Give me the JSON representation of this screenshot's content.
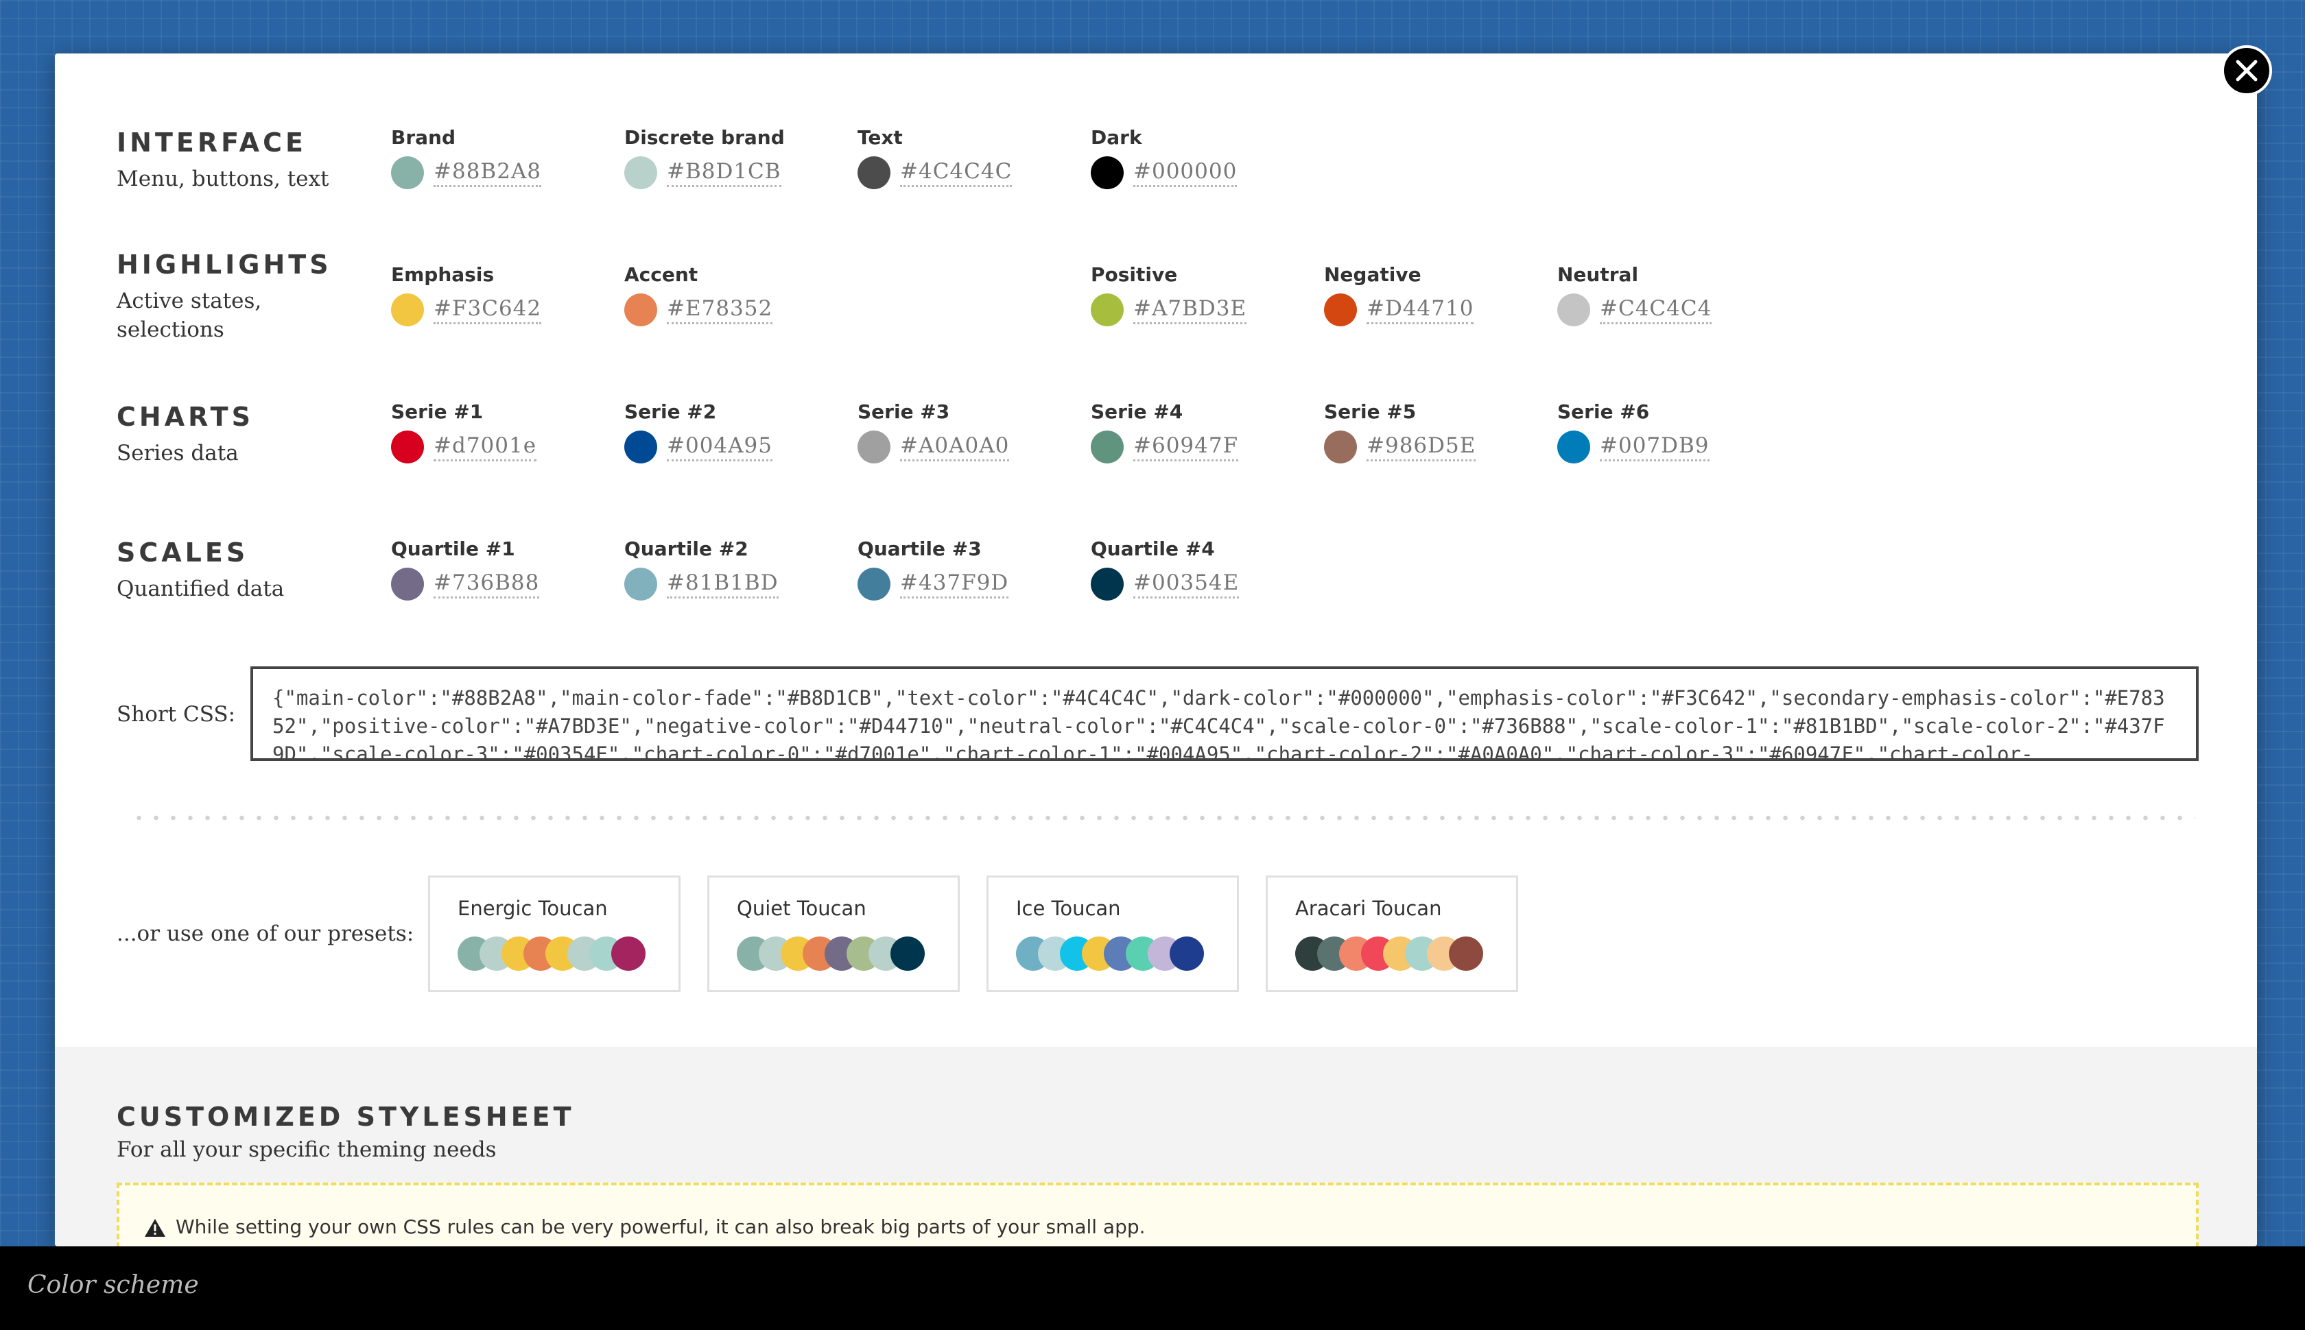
{
  "interface": {
    "title": "INTERFACE",
    "subtitle": "Menu, buttons, text",
    "swatches": [
      {
        "label": "Brand",
        "hex": "#88B2A8"
      },
      {
        "label": "Discrete brand",
        "hex": "#B8D1CB"
      },
      {
        "label": "Text",
        "hex": "#4C4C4C"
      },
      {
        "label": "Dark",
        "hex": "#000000"
      }
    ]
  },
  "highlights": {
    "title": "HIGHLIGHTS",
    "subtitle": "Active states, selections",
    "swatches": [
      {
        "label": "Emphasis",
        "hex": "#F3C642"
      },
      {
        "label": "Accent",
        "hex": "#E78352"
      },
      {
        "label": "Positive",
        "hex": "#A7BD3E"
      },
      {
        "label": "Negative",
        "hex": "#D44710"
      },
      {
        "label": "Neutral",
        "hex": "#C4C4C4"
      }
    ]
  },
  "charts": {
    "title": "CHARTS",
    "subtitle": "Series data",
    "swatches": [
      {
        "label": "Serie #1",
        "hex": "#d7001e"
      },
      {
        "label": "Serie #2",
        "hex": "#004A95"
      },
      {
        "label": "Serie #3",
        "hex": "#A0A0A0"
      },
      {
        "label": "Serie #4",
        "hex": "#60947F"
      },
      {
        "label": "Serie #5",
        "hex": "#986D5E"
      },
      {
        "label": "Serie #6",
        "hex": "#007DB9"
      }
    ]
  },
  "scales": {
    "title": "SCALES",
    "subtitle": "Quantified data",
    "swatches": [
      {
        "label": "Quartile #1",
        "hex": "#736B88"
      },
      {
        "label": "Quartile #2",
        "hex": "#81B1BD"
      },
      {
        "label": "Quartile #3",
        "hex": "#437F9D"
      },
      {
        "label": "Quartile #4",
        "hex": "#00354E"
      }
    ]
  },
  "short_css": {
    "label": "Short CSS:",
    "value": "{\"main-color\":\"#88B2A8\",\"main-color-fade\":\"#B8D1CB\",\"text-color\":\"#4C4C4C\",\"dark-color\":\"#000000\",\"emphasis-color\":\"#F3C642\",\"secondary-emphasis-color\":\"#E78352\",\"positive-color\":\"#A7BD3E\",\"negative-color\":\"#D44710\",\"neutral-color\":\"#C4C4C4\",\"scale-color-0\":\"#736B88\",\"scale-color-1\":\"#81B1BD\",\"scale-color-2\":\"#437F9D\",\"scale-color-3\":\"#00354E\",\"chart-color-0\":\"#d7001e\",\"chart-color-1\":\"#004A95\",\"chart-color-2\":\"#A0A0A0\",\"chart-color-3\":\"#60947F\",\"chart-color-"
  },
  "presets": {
    "label": "...or use one of our presets:",
    "items": [
      {
        "name": "Energic Toucan",
        "colors": [
          "#88B2A8",
          "#B8D1CB",
          "#F3C642",
          "#E78352",
          "#F3C642",
          "#B8D1CB",
          "#A7D4CC",
          "#A3245F"
        ]
      },
      {
        "name": "Quiet Toucan",
        "colors": [
          "#88B2A8",
          "#B8D1CB",
          "#F3C642",
          "#E78352",
          "#736B88",
          "#A7BD8E",
          "#B8D1CB",
          "#00354E"
        ]
      },
      {
        "name": "Ice Toucan",
        "colors": [
          "#6FB0C4",
          "#B8D8DC",
          "#13C2E8",
          "#F3C642",
          "#5D7DB8",
          "#5BD0B0",
          "#C4B6D8",
          "#1F3D8F"
        ]
      },
      {
        "name": "Aracari Toucan",
        "colors": [
          "#2F3F3E",
          "#5B7370",
          "#F2866B",
          "#F04858",
          "#F5C76A",
          "#A7D4CC",
          "#F5C98F",
          "#8E4A3E"
        ]
      }
    ]
  },
  "custom_stylesheet": {
    "title": "CUSTOMIZED STYLESHEET",
    "subtitle": "For all your specific theming needs",
    "warning": "While setting your own CSS rules can be very powerful, it can also break big parts of your small app."
  },
  "caption": "Color scheme"
}
